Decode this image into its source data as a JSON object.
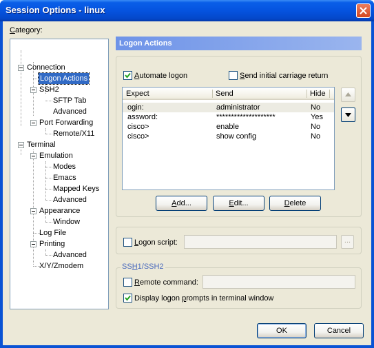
{
  "window": {
    "title": "Session Options - linux"
  },
  "category": {
    "label_prefix": "",
    "label_u": "C",
    "label_rest": "ategory:"
  },
  "tree": {
    "connection": "Connection",
    "logon_actions": "Logon Actions",
    "ssh2": "SSH2",
    "sftp_tab": "SFTP Tab",
    "ssh2_advanced": "Advanced",
    "port_forwarding": "Port Forwarding",
    "remote_x11": "Remote/X11",
    "terminal": "Terminal",
    "emulation": "Emulation",
    "modes": "Modes",
    "emacs": "Emacs",
    "mapped_keys": "Mapped Keys",
    "emulation_advanced": "Advanced",
    "appearance": "Appearance",
    "window": "Window",
    "log_file": "Log File",
    "printing": "Printing",
    "printing_advanced": "Advanced",
    "xyzmodem": "X/Y/Zmodem"
  },
  "section": {
    "title": "Logon Actions"
  },
  "automate_logon": {
    "u": "A",
    "rest": "utomate logon",
    "checked": true
  },
  "send_cr": {
    "u": "S",
    "rest": "end initial carriage return",
    "checked": false
  },
  "table": {
    "columns": [
      "Expect",
      "Send",
      "Hide"
    ],
    "rows": [
      {
        "expect": "ogin:",
        "send": "administrator",
        "hide": "No"
      },
      {
        "expect": "assword:",
        "send": "********************",
        "hide": "Yes"
      },
      {
        "expect": "cisco>",
        "send": "enable",
        "hide": "No"
      },
      {
        "expect": "cisco>",
        "send": "show config",
        "hide": "No"
      }
    ]
  },
  "buttons": {
    "add_u": "A",
    "add_rest": "dd...",
    "edit_u": "E",
    "edit_rest": "dit...",
    "delete_u": "D",
    "delete_rest": "elete",
    "ok": "OK",
    "cancel": "Cancel"
  },
  "logon_script": {
    "u": "L",
    "rest": "ogon script:",
    "browse": "...",
    "value": ""
  },
  "ssh_group": {
    "title_u": "H",
    "title_prefix": "SS",
    "title_rest": "1/SSH2"
  },
  "remote_command": {
    "u": "R",
    "rest": "emote command:",
    "value": ""
  },
  "display_prompts": {
    "pre": "Display logon ",
    "u": "p",
    "rest": "rompts in terminal window",
    "checked": true
  },
  "colors": {
    "titlebar": "#0553df",
    "selection": "#316ac5",
    "header": "#7a96df",
    "client": "#ece9d8"
  }
}
